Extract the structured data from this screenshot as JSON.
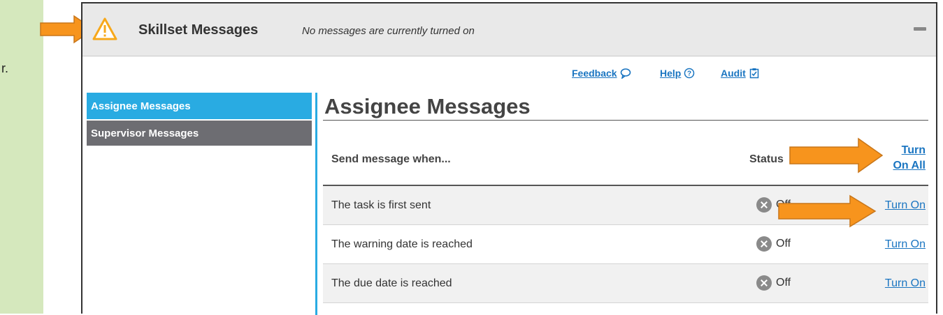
{
  "left_fragment": "r.",
  "panel": {
    "title": "Skillset Messages",
    "subtitle": "No messages are currently turned on",
    "icons": {
      "warning": "warning-triangle-icon",
      "collapse": "minus-icon"
    }
  },
  "toplinks": {
    "feedback": "Feedback",
    "help": "Help",
    "audit": "Audit"
  },
  "sidebar": {
    "items": [
      {
        "label": "Assignee Messages",
        "active": true
      },
      {
        "label": "Supervisor Messages",
        "active": false
      }
    ]
  },
  "content": {
    "title": "Assignee Messages",
    "columns": {
      "send": "Send message when...",
      "status": "Status",
      "turn_on_all_line1": "Turn",
      "turn_on_all_line2": "On All"
    },
    "rows": [
      {
        "message": "The task is first sent",
        "status": "Off",
        "action": "Turn On"
      },
      {
        "message": "The warning date is reached",
        "status": "Off",
        "action": "Turn On"
      },
      {
        "message": "The due date is reached",
        "status": "Off",
        "action": "Turn On"
      }
    ]
  },
  "colors": {
    "accent_blue": "#29abe2",
    "link_blue": "#1a75c1",
    "annotation_orange": "#f7941d",
    "left_strip": "#d5e8bd"
  }
}
